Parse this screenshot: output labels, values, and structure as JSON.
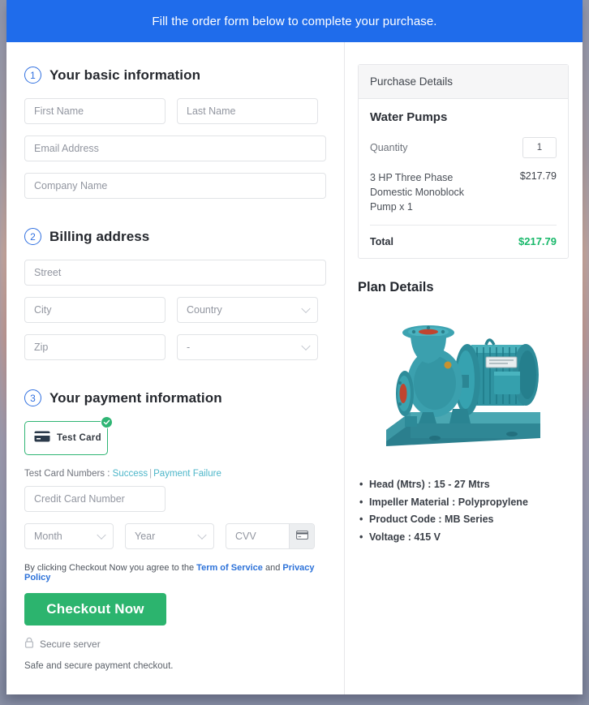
{
  "banner": {
    "message": "Fill the order form below to complete your purchase."
  },
  "colors": {
    "banner_blue": "#1f6ceb",
    "accent_green": "#2cb46e",
    "total_green": "#18b86a",
    "link_blue": "#2d72d9",
    "testcard_link": "#4cb6c9"
  },
  "steps": [
    {
      "number": "1",
      "title": "Your basic information"
    },
    {
      "number": "2",
      "title": "Billing address"
    },
    {
      "number": "3",
      "title": "Your payment information"
    }
  ],
  "basic_info": {
    "first_name": {
      "placeholder": "First Name",
      "value": ""
    },
    "last_name": {
      "placeholder": "Last Name",
      "value": ""
    },
    "email": {
      "placeholder": "Email Address",
      "value": ""
    },
    "company": {
      "placeholder": "Company Name",
      "value": ""
    }
  },
  "billing": {
    "street": {
      "placeholder": "Street",
      "value": ""
    },
    "city": {
      "placeholder": "City",
      "value": ""
    },
    "country": {
      "placeholder": "Country",
      "value": ""
    },
    "zip": {
      "placeholder": "Zip",
      "value": ""
    },
    "state": {
      "placeholder": "-",
      "value": "-"
    }
  },
  "payment": {
    "method_label": "Test Card",
    "method_selected": true,
    "test_cards_prefix": "Test Card Numbers :",
    "test_card_success": "Success",
    "test_card_failure": "Payment Failure",
    "card_number": {
      "placeholder": "Credit Card Number",
      "value": ""
    },
    "month": {
      "placeholder": "Month",
      "value": ""
    },
    "year": {
      "placeholder": "Year",
      "value": ""
    },
    "cvv": {
      "placeholder": "CVV",
      "value": ""
    }
  },
  "terms": {
    "prefix": "By clicking Checkout Now you agree to the",
    "link1": "Term of Service",
    "joiner": "and",
    "link2": "Privacy Policy"
  },
  "checkout": {
    "button_label": "Checkout Now",
    "secure_label": "Secure server",
    "safe_note": "Safe and secure payment checkout."
  },
  "purchase_details": {
    "header": "Purchase Details",
    "product": "Water Pumps",
    "quantity_label": "Quantity",
    "quantity_value": "1",
    "line_item_desc": "3 HP Three Phase Domestic Monoblock Pump x 1",
    "line_item_amount": "$217.79",
    "total_label": "Total",
    "total_amount": "$217.79"
  },
  "plan_details": {
    "title": "Plan Details",
    "image_alt": "water-pump-product-photo",
    "specs": [
      "Head (Mtrs) : 15 - 27 Mtrs",
      "Impeller Material : Polypropylene",
      "Product Code : MB Series",
      "Voltage : 415 V"
    ]
  }
}
